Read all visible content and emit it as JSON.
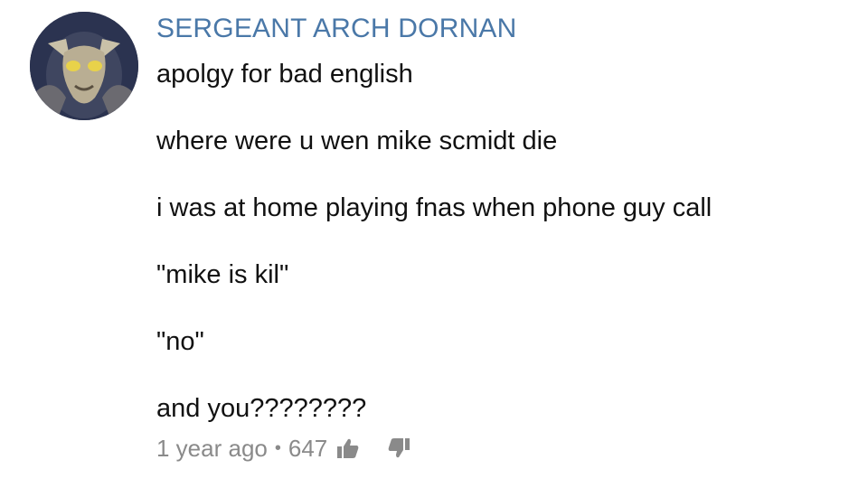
{
  "comment": {
    "author": "SERGEANT ARCH DORNAN",
    "lines": [
      "apolgy for bad english",
      "where were u wen mike scmidt die",
      "i was at home playing fnas when phone guy call",
      "\"mike is kil\"",
      "\"no\"",
      "and you????????"
    ],
    "timestamp": "1 year ago",
    "separator": "•",
    "like_count": "647",
    "icons": [
      "avatar",
      "thumb-up-icon",
      "thumb-down-icon"
    ]
  }
}
